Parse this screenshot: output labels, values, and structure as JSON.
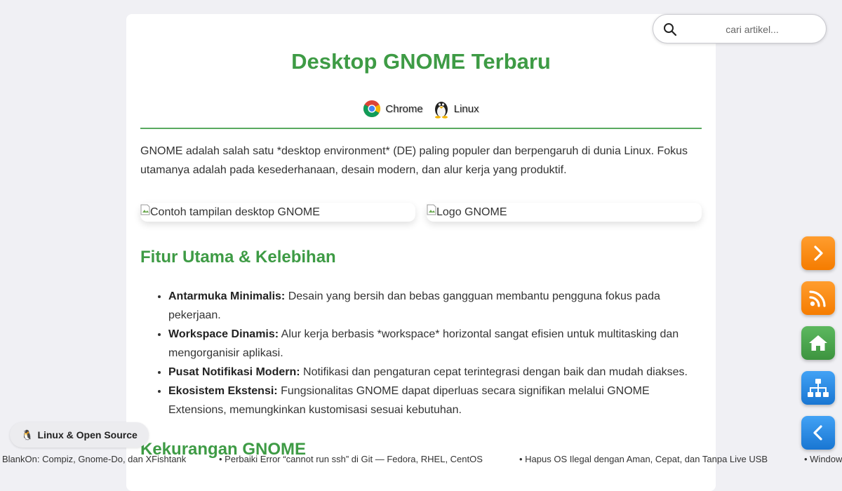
{
  "article": {
    "title": "Desktop GNOME Terbaru",
    "tags": [
      {
        "label": "Chrome",
        "icon": "chrome-icon"
      },
      {
        "label": "Linux",
        "icon": "tux-penguin-icon"
      }
    ],
    "intro": "GNOME adalah salah satu *desktop environment* (DE) paling populer dan berpengaruh di dunia Linux. Fokus utamanya adalah pada kesederhanaan, desain modern, dan alur kerja yang produktif.",
    "images": [
      {
        "alt": "Contoh tampilan desktop GNOME"
      },
      {
        "alt": "Logo GNOME"
      }
    ],
    "features_heading": "Fitur Utama & Kelebihan",
    "features": [
      {
        "term": "Antarmuka Minimalis:",
        "desc": " Desain yang bersih dan bebas gangguan membantu pengguna fokus pada pekerjaan."
      },
      {
        "term": "Workspace Dinamis:",
        "desc": " Alur kerja berbasis *workspace* horizontal sangat efisien untuk multitasking dan mengorganisir aplikasi."
      },
      {
        "term": "Pusat Notifikasi Modern:",
        "desc": " Notifikasi dan pengaturan cepat terintegrasi dengan baik dan mudah diakses."
      },
      {
        "term": "Ekosistem Ekstensi:",
        "desc": " Fungsionalitas GNOME dapat diperluas secara signifikan melalui GNOME Extensions, memungkinkan kustomisasi sesuai kebutuhan."
      }
    ],
    "drawbacks_heading": "Kekurangan GNOME"
  },
  "search": {
    "placeholder": "cari artikel...",
    "value": ""
  },
  "side_buttons": [
    {
      "name": "next-button",
      "icon": "chevron-right-icon",
      "color": "#f57c00"
    },
    {
      "name": "rss-button",
      "icon": "rss-icon",
      "color": "#f57c00"
    },
    {
      "name": "home-button",
      "icon": "home-icon",
      "color": "#3d943f"
    },
    {
      "name": "sitemap-button",
      "icon": "sitemap-icon",
      "color": "#1976d2"
    },
    {
      "name": "back-button",
      "icon": "chevron-left-icon",
      "color": "#1976d2"
    }
  ],
  "badge": {
    "emoji": "🐧",
    "label": "Linux & Open Source"
  },
  "ticker": [
    "BlankOn: Compiz, Gnome-Do, dan XFishtank",
    "• Perbaiki Error “cannot run ssh” di Git — Fedora, RHEL, CentOS",
    "• Hapus OS Ilegal dengan Aman, Cepat, dan Tanpa Live USB",
    "• Window"
  ],
  "colors": {
    "accent_green": "#3e9b45",
    "orange": "#f57c00",
    "blue": "#1976d2",
    "green": "#3d943f"
  }
}
